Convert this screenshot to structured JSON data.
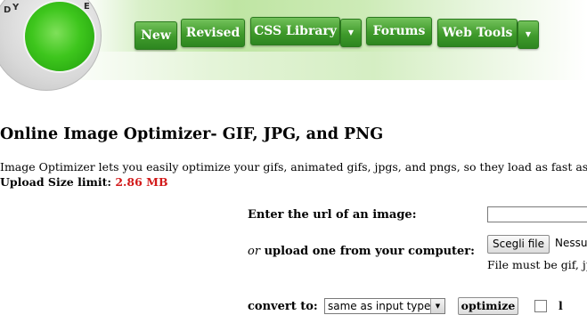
{
  "logo": {
    "letters": [
      "D",
      "Y",
      "E"
    ]
  },
  "nav": {
    "items": [
      {
        "label": "New"
      },
      {
        "label": "Revised"
      },
      {
        "label": "CSS Library"
      },
      {
        "label": "Forums"
      },
      {
        "label": "Web Tools"
      }
    ],
    "dropdown_arrow": "▼"
  },
  "page": {
    "title": "Online Image Optimizer- GIF, JPG, and PNG",
    "intro": "Image Optimizer lets you easily optimize your gifs, animated gifs, jpgs, and pngs, so they load as fast as pos",
    "upload_limit_label": "Upload Size limit:",
    "upload_limit_value": "2.86 MB"
  },
  "form": {
    "url_label": "Enter the url of an image:",
    "url_value": "",
    "upload_or": "or",
    "upload_label": "upload one from your computer:",
    "file_button": "Scegli file",
    "file_status": "Nessu",
    "file_note": "File must be gif, jp",
    "convert_label": "convert to:",
    "convert_selected": "same as input type",
    "select_arrow": "▼",
    "optimize_button": "optimize",
    "checkbox_label": "l"
  },
  "colors": {
    "nav_green": "#3f9a2b",
    "limit_red": "#d21a1a",
    "logo_green": "#3ec61d"
  }
}
